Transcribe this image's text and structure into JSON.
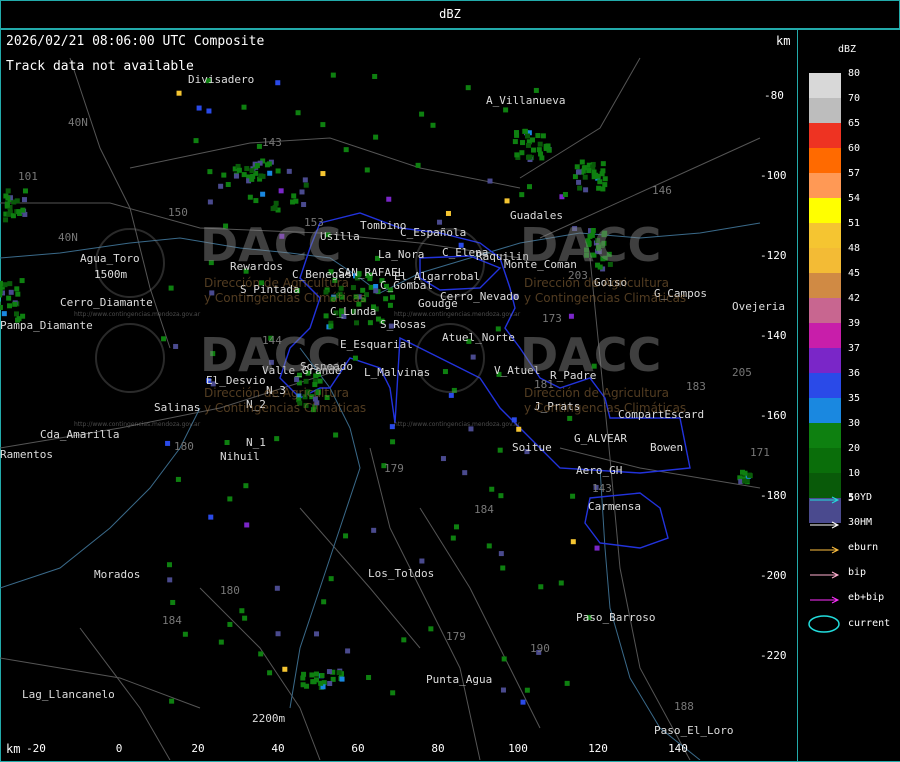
{
  "title": "dBZ",
  "header": "2026/02/21 08:06:00 UTC Composite",
  "track_message": "Track data not available",
  "km_label": "km",
  "y_ticks": [
    "-80",
    "-100",
    "-120",
    "-140",
    "-160",
    "-180",
    "-200",
    "-220"
  ],
  "x_ticks": [
    "-20",
    "0",
    "20",
    "40",
    "60",
    "80",
    "100",
    "120",
    "140"
  ],
  "legend": {
    "title": "dBZ",
    "scale": [
      {
        "label": "80",
        "color": "#d8d8d8"
      },
      {
        "label": "70",
        "color": "#bdbdbd"
      },
      {
        "label": "65",
        "color": "#ee3322"
      },
      {
        "label": "60",
        "color": "#ff6a00"
      },
      {
        "label": "57",
        "color": "#ff9955"
      },
      {
        "label": "54",
        "color": "#ffff00"
      },
      {
        "label": "51",
        "color": "#f5c531"
      },
      {
        "label": "48",
        "color": "#f3bb35"
      },
      {
        "label": "45",
        "color": "#d08a44"
      },
      {
        "label": "42",
        "color": "#c86690"
      },
      {
        "label": "39",
        "color": "#c81eaa"
      },
      {
        "label": "37",
        "color": "#7a26c8"
      },
      {
        "label": "36",
        "color": "#2a4ae8"
      },
      {
        "label": "35",
        "color": "#1a88e0"
      },
      {
        "label": "30",
        "color": "#0e8010"
      },
      {
        "label": "20",
        "color": "#0a6e0a"
      },
      {
        "label": "10",
        "color": "#095a09"
      },
      {
        "label": "5",
        "color": "#4a4a8e"
      }
    ],
    "tracks": [
      {
        "label": "50YD",
        "color": "#22dddd"
      },
      {
        "label": "30HM",
        "color": "#ffffff"
      },
      {
        "label": "eburn",
        "color": "#ffc040"
      },
      {
        "label": "bip",
        "color": "#ffb0d0"
      },
      {
        "label": "eb+bip",
        "color": "#ff30ff"
      }
    ],
    "current_label": "current",
    "current_color": "#22dddd"
  },
  "places": [
    "Divisadero",
    "A_Villanueva",
    "Guadales",
    "Tombino",
    "Usilla",
    "C_Española",
    "La_Nora",
    "C_Elena",
    "Goudge",
    "Agua_Toro",
    "Rewardos",
    "Monte_Coman",
    "Raquilin",
    "C_Benegas",
    "SAN_RAFAEL",
    "El_Algarrobal",
    "Goiso",
    "G_Campos",
    "Ovejeria",
    "Pampa_Diamante",
    "S_Pintada",
    "C_Lunda",
    "C_Gombal",
    "Cerro_Nevado",
    "S_Rosas",
    "Atuel_Norte",
    "E_Esquarial",
    "V_Atuel",
    "R_Padre",
    "El_Desvio",
    "Valle_Grande",
    "L_Malvinas",
    "J_Prats",
    "CompartEscard",
    "Salinas",
    "G_ALVEAR",
    "Cda_Amarilla",
    "Soitue",
    "Bowen",
    "Nihuil",
    "Aero_GH",
    "Carmensa",
    "Morados",
    "Los_Toldos",
    "Paso_Barroso",
    "Lag_Llancanelo",
    "Punta_Agua",
    "Paso_El_Loro",
    "Ramentos",
    "Cerro_Diamante",
    "Sosneado",
    "2200m",
    "1500m",
    "N_1",
    "N_2",
    "N_3"
  ],
  "roads": [
    "143",
    "146",
    "153",
    "150",
    "101",
    "40N",
    "173",
    "40N",
    "181",
    "203",
    "144",
    "184",
    "179",
    "205",
    "180",
    "184",
    "171",
    "183",
    "190",
    "179",
    "143",
    "180",
    "188"
  ],
  "watermark": {
    "brand": "DACC",
    "line1": "Dirección de Agricultura",
    "line2": "y Contingencias Climáticas",
    "url": "http://www.contingencias.mendoza.gov.ar"
  }
}
